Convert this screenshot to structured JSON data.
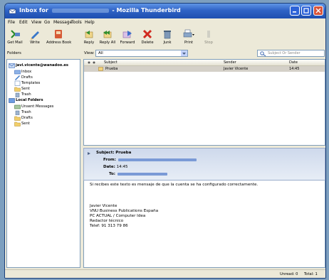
{
  "window": {
    "title_left": "Inbox for",
    "title_right": "- Mozilla Thunderbird"
  },
  "menu": [
    "File",
    "Edit",
    "View",
    "Go",
    "Message",
    "Tools",
    "Help"
  ],
  "toolbar": {
    "get_mail": "Get Mail",
    "write": "Write",
    "address_book": "Address Book",
    "reply": "Reply",
    "reply_all": "Reply All",
    "forward": "Forward",
    "delete": "Delete",
    "junk": "Junk",
    "print": "Print",
    "stop": "Stop"
  },
  "filter": {
    "folders_label": "Folders",
    "view_label": "View:",
    "view_value": "All",
    "search_placeholder": "Subject Or Sender"
  },
  "folders": {
    "account": "javi.vicente@wanadoo.es",
    "inbox": "Inbox",
    "drafts": "Drafts",
    "templates": "Templates",
    "sent": "Sent",
    "trash": "Trash",
    "local": "Local Folders",
    "unsent": "Unsent Messages",
    "local_trash": "Trash",
    "local_drafts": "Drafts",
    "local_sent": "Sent"
  },
  "thread": {
    "columns": {
      "subject": "Subject",
      "sender": "Sender",
      "date": "Date"
    },
    "rows": [
      {
        "subject": "Prueba",
        "sender": "Javier Vicente",
        "date": "14:45"
      }
    ]
  },
  "message": {
    "subject_label": "Subject:",
    "subject": "Prueba",
    "from_label": "From:",
    "date_label": "Date:",
    "date": "14:45",
    "to_label": "To:",
    "body": [
      "Si recibes este texto es mensaje de que la cuenta se ha configurado correctamente.",
      "Javier Vicente",
      "VNU Business Publications España",
      "PC ACTUAL / Computer Idea",
      "Redactor técnico",
      "Telef: 91 313 79 86"
    ]
  },
  "status": {
    "unread": "Unread: 0",
    "total": "Total: 1"
  },
  "colors": {
    "titlebar": "#2f63c6",
    "chrome": "#ece9d8",
    "selected_row": "#d4d0c8",
    "header_bg": "#ced9ec"
  }
}
